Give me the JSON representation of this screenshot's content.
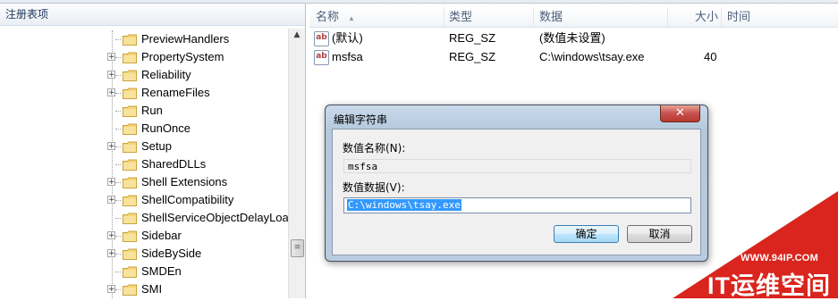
{
  "tree": {
    "header": "注册表项",
    "items": [
      {
        "label": "PreviewHandlers",
        "expandable": false
      },
      {
        "label": "PropertySystem",
        "expandable": true
      },
      {
        "label": "Reliability",
        "expandable": true
      },
      {
        "label": "RenameFiles",
        "expandable": true
      },
      {
        "label": "Run",
        "expandable": false
      },
      {
        "label": "RunOnce",
        "expandable": false
      },
      {
        "label": "Setup",
        "expandable": true
      },
      {
        "label": "SharedDLLs",
        "expandable": false
      },
      {
        "label": "Shell Extensions",
        "expandable": true
      },
      {
        "label": "ShellCompatibility",
        "expandable": true
      },
      {
        "label": "ShellServiceObjectDelayLoad",
        "expandable": false
      },
      {
        "label": "Sidebar",
        "expandable": true
      },
      {
        "label": "SideBySide",
        "expandable": true
      },
      {
        "label": "SMDEn",
        "expandable": false
      },
      {
        "label": "SMI",
        "expandable": true
      }
    ],
    "selected": "RunOnce"
  },
  "list": {
    "columns": {
      "name": "名称",
      "type": "类型",
      "data": "数据",
      "size": "大小",
      "time": "时间"
    },
    "rows": [
      {
        "icon": "string-value-icon",
        "name": "(默认)",
        "type": "REG_SZ",
        "data": "(数值未设置)",
        "size": ""
      },
      {
        "icon": "string-value-icon",
        "name": "msfsa",
        "type": "REG_SZ",
        "data": "C:\\windows\\tsay.exe",
        "size": "40"
      }
    ]
  },
  "dialog": {
    "title": "编辑字符串",
    "close_glyph": "✕",
    "name_label": "数值名称(N):",
    "name_value": "msfsa",
    "data_label": "数值数据(V):",
    "data_value": "C:\\windows\\tsay.exe",
    "ok_label": "确定",
    "cancel_label": "取消"
  },
  "watermark": {
    "url": "WWW.94IP.COM",
    "title": "IT运维空间",
    "color": "#d9251d"
  },
  "icons": {
    "folder": "folder-icon",
    "expander": "plus",
    "string_value": "ab"
  }
}
